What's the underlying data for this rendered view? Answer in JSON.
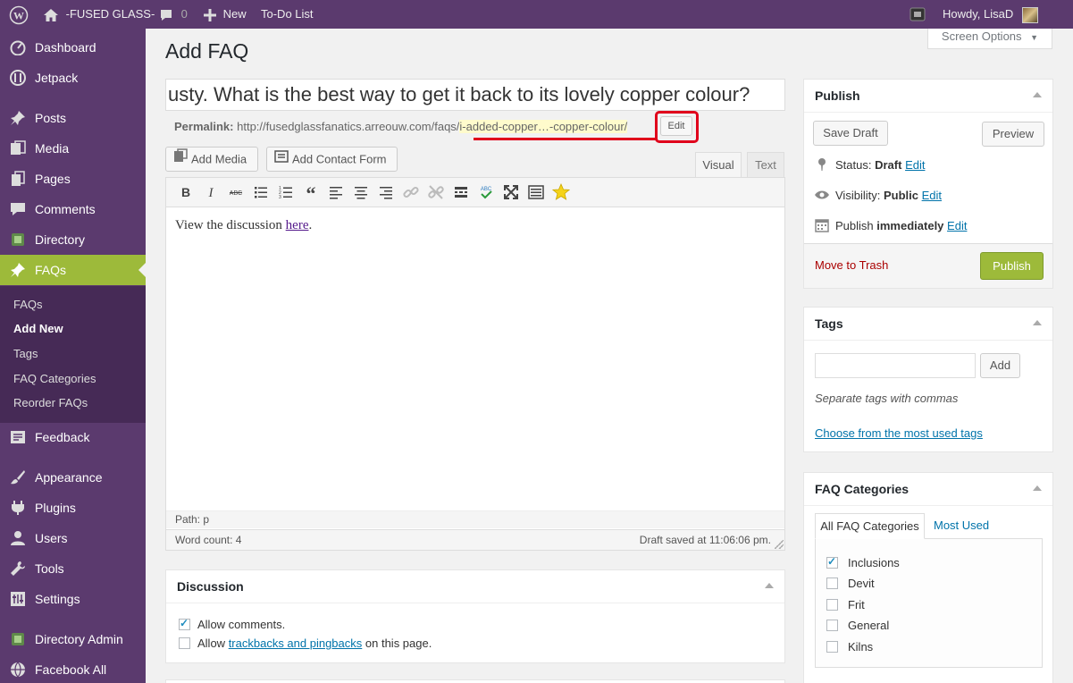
{
  "admin_bar": {
    "site_name": "-FUSED GLASS-",
    "comments_count": "0",
    "new_label": "New",
    "todo_label": "To-Do List",
    "howdy": "Howdy, LisaD"
  },
  "sidebar": {
    "items": [
      {
        "label": "Dashboard"
      },
      {
        "label": "Jetpack"
      },
      {
        "label": "Posts"
      },
      {
        "label": "Media"
      },
      {
        "label": "Pages"
      },
      {
        "label": "Comments"
      },
      {
        "label": "Directory"
      },
      {
        "label": "FAQs"
      },
      {
        "label": "Feedback"
      },
      {
        "label": "Appearance"
      },
      {
        "label": "Plugins"
      },
      {
        "label": "Users"
      },
      {
        "label": "Tools"
      },
      {
        "label": "Settings"
      },
      {
        "label": "Directory Admin"
      },
      {
        "label": "Facebook All"
      }
    ],
    "submenu": [
      {
        "label": "FAQs"
      },
      {
        "label": "Add New"
      },
      {
        "label": "Tags"
      },
      {
        "label": "FAQ Categories"
      },
      {
        "label": "Reorder FAQs"
      }
    ]
  },
  "screen_options": "Screen Options",
  "page_title": "Add FAQ",
  "post": {
    "title_visible": "usty. What is the best way to get it back to its lovely copper colour?",
    "permalink_label": "Permalink:",
    "permalink_base": "http://fusedglassfanatics.arreouw.com/faqs/",
    "permalink_slug": "i-added-copper…-copper-colour/",
    "edit_label": "Edit"
  },
  "media": {
    "add_media": "Add Media",
    "add_contact_form": "Add Contact Form"
  },
  "editor": {
    "tab_visual": "Visual",
    "tab_text": "Text",
    "content_prefix": "View the discussion ",
    "content_link": "here",
    "content_suffix": ".",
    "path": "Path: p",
    "word_count": "Word count: 4",
    "draft_saved": "Draft saved at 11:06:06 pm."
  },
  "discussion": {
    "title": "Discussion",
    "allow_comments": "Allow comments.",
    "allow_prefix": "Allow ",
    "trackbacks_link": "trackbacks and pingbacks",
    "allow_suffix": " on this page."
  },
  "publish": {
    "title": "Publish",
    "save_draft": "Save Draft",
    "preview": "Preview",
    "status_label": "Status:",
    "status_value": "Draft",
    "visibility_label": "Visibility:",
    "visibility_value": "Public",
    "publish_label": "Publish",
    "publish_value": "immediately",
    "edit": "Edit",
    "trash": "Move to Trash",
    "publish_button": "Publish"
  },
  "tags": {
    "title": "Tags",
    "add": "Add",
    "hint": "Separate tags with commas",
    "choose": "Choose from the most used tags"
  },
  "faq_categories": {
    "title": "FAQ Categories",
    "tab_all": "All FAQ Categories",
    "tab_most_used": "Most Used",
    "items": [
      {
        "label": "Inclusions",
        "checked": true
      },
      {
        "label": "Devit",
        "checked": false
      },
      {
        "label": "Frit",
        "checked": false
      },
      {
        "label": "General",
        "checked": false
      },
      {
        "label": "Kilns",
        "checked": false
      }
    ]
  },
  "colors": {
    "admin_purple": "#5b3a6e",
    "submenu_purple": "#462a56",
    "active_green": "#9dba3a",
    "publish_green": "#9dba3a",
    "highlight_red": "#e0001b"
  }
}
